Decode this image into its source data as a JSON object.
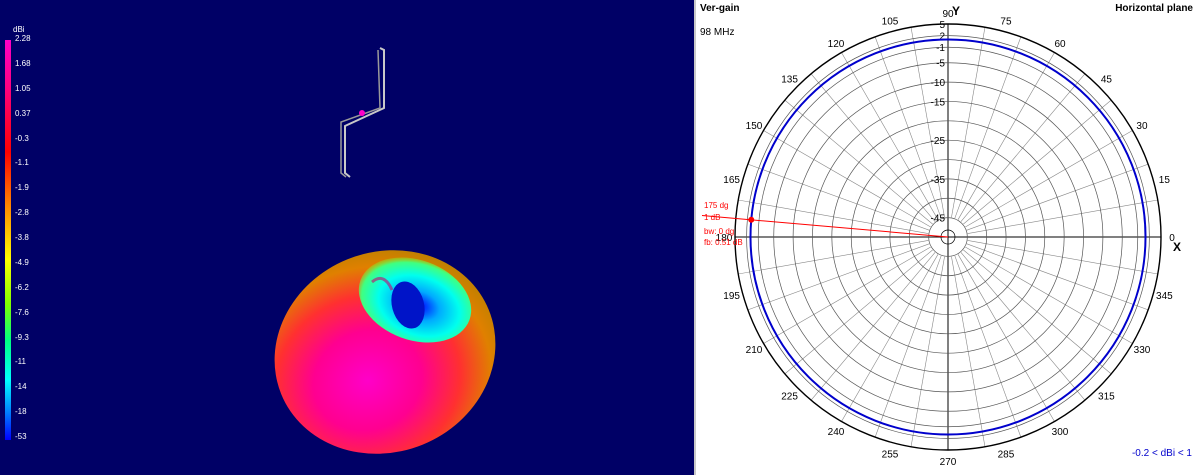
{
  "view3d": {
    "scale_unit": "dBi",
    "scale_labels": [
      "2.28",
      "1.68",
      "1.05",
      "0.37",
      "-0.3",
      "-1.1",
      "-1.9",
      "-2.8",
      "-3.8",
      "-4.9",
      "-6.2",
      "-7.6",
      "-9.3",
      "-11",
      "-14",
      "-18",
      "-53"
    ]
  },
  "polar": {
    "title_left": "Ver-gain",
    "title_right": "Horizontal plane",
    "frequency": "98 MHz",
    "axis_y_label": "Y",
    "axis_x_label": "X",
    "angle_labels": [
      {
        "deg": 0,
        "text": "0"
      },
      {
        "deg": 15,
        "text": "15"
      },
      {
        "deg": 30,
        "text": "30"
      },
      {
        "deg": 45,
        "text": "45"
      },
      {
        "deg": 60,
        "text": "60"
      },
      {
        "deg": 75,
        "text": "75"
      },
      {
        "deg": 90,
        "text": "90"
      },
      {
        "deg": 105,
        "text": "105"
      },
      {
        "deg": 120,
        "text": "120"
      },
      {
        "deg": 135,
        "text": "135"
      },
      {
        "deg": 150,
        "text": "150"
      },
      {
        "deg": 165,
        "text": "165"
      },
      {
        "deg": 180,
        "text": "180"
      },
      {
        "deg": 195,
        "text": "195"
      },
      {
        "deg": 210,
        "text": "210"
      },
      {
        "deg": 225,
        "text": "225"
      },
      {
        "deg": 240,
        "text": "240"
      },
      {
        "deg": 255,
        "text": "255"
      },
      {
        "deg": 270,
        "text": "270"
      },
      {
        "deg": 285,
        "text": "285"
      },
      {
        "deg": 300,
        "text": "300"
      },
      {
        "deg": 315,
        "text": "315"
      },
      {
        "deg": 330,
        "text": "330"
      },
      {
        "deg": 345,
        "text": "345"
      }
    ],
    "db_ticks": [
      "5",
      "2",
      "-1",
      "-5",
      "-10",
      "-15",
      "-25",
      "-35",
      "-45"
    ],
    "db_range": [
      -50,
      5
    ],
    "pattern_gain_db": 1,
    "marker": {
      "angle_deg": 175,
      "gain_db": 1,
      "line1": "175 dg",
      "line2": "1 dB",
      "line3": "bw: 0 dg",
      "line4": "fb: 0.51 dB"
    },
    "range_text": "-0.2 < dBi < 1",
    "colors": {
      "pattern": "#0000cc",
      "marker": "#ff0000",
      "grid": "#000000",
      "range_text": "#0000cc"
    }
  }
}
